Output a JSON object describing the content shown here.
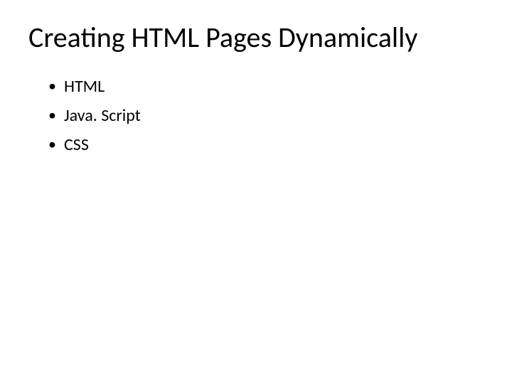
{
  "slide": {
    "title": "Creating HTML Pages Dynamically",
    "bullets": [
      "HTML",
      "Java. Script",
      "CSS"
    ]
  }
}
